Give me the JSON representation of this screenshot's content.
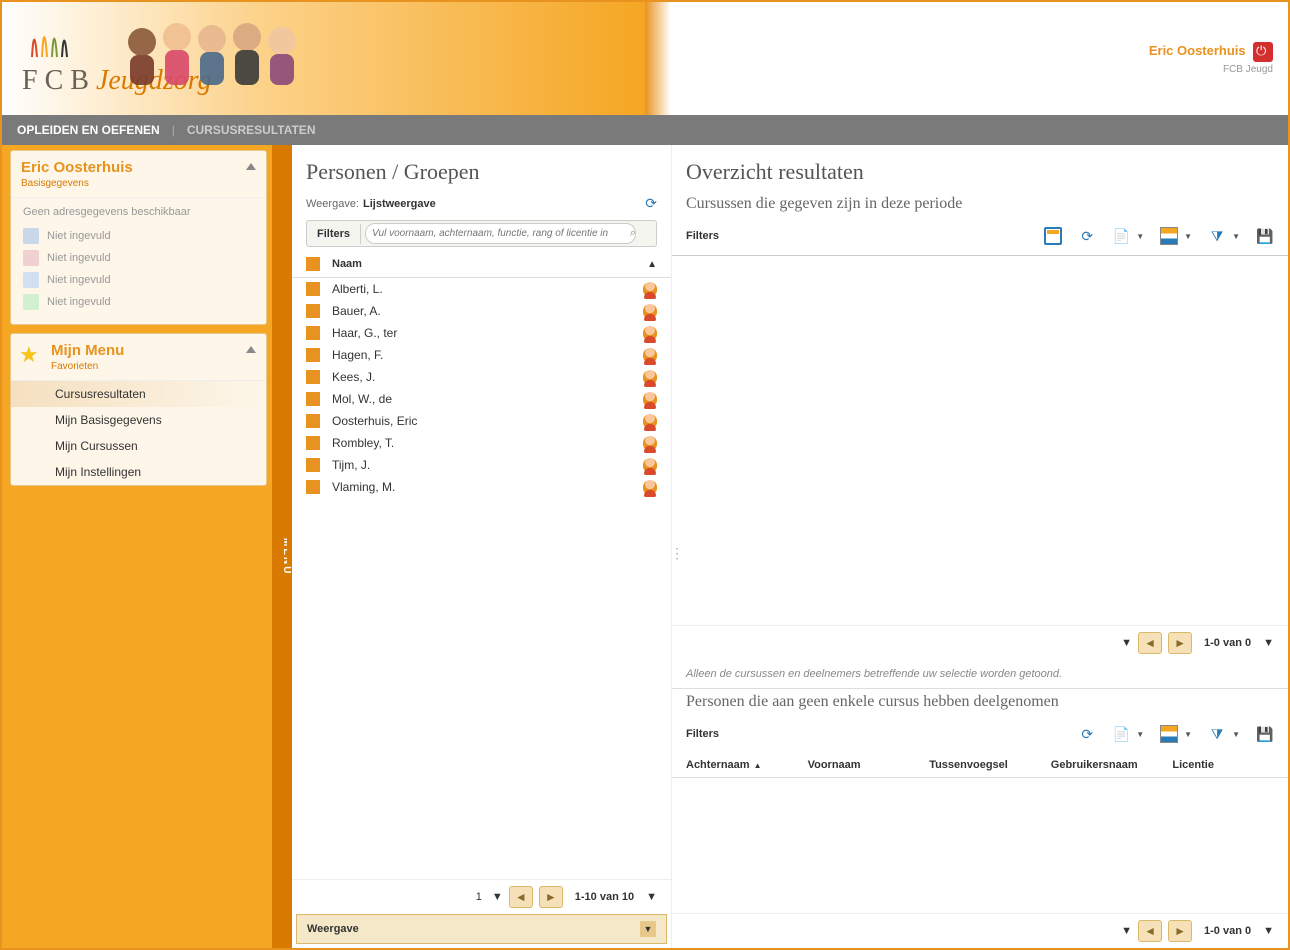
{
  "header": {
    "logo_main": "F C B",
    "logo_accent": "Jeugdzorg",
    "user_name": "Eric Oosterhuis",
    "user_org": "FCB Jeugd"
  },
  "nav": {
    "main": "OPLEIDEN EN OEFENEN",
    "sep": "|",
    "sub": "CURSUSRESULTATEN"
  },
  "sidebar": {
    "menu_tab": "MENU",
    "user_panel": {
      "title": "Eric Oosterhuis",
      "subtitle": "Basisgegevens",
      "no_address": "Geen adresgegevens beschikbaar",
      "lines": [
        "Niet ingevuld",
        "Niet ingevuld",
        "Niet ingevuld",
        "Niet ingevuld"
      ]
    },
    "menu_panel": {
      "title": "Mijn Menu",
      "subtitle": "Favorieten",
      "items": [
        "Cursusresultaten",
        "Mijn Basisgegevens",
        "Mijn Cursussen",
        "Mijn Instellingen"
      ]
    }
  },
  "left_col": {
    "title": "Personen / Groepen",
    "view_label": "Weergave:",
    "view_value": "Lijstweergave",
    "filter_label": "Filters",
    "filter_placeholder": "Vul voornaam, achternaam, functie, rang of licentie in",
    "name_header": "Naam",
    "persons": [
      "Alberti, L.",
      "Bauer, A.",
      "Haar, G., ter",
      "Hagen, F.",
      "Kees, J.",
      "Mol, W., de",
      "Oosterhuis, Eric",
      "Rombley, T.",
      "Tijm, J.",
      "Vlaming, M."
    ],
    "pager": {
      "page": "1",
      "range": "1-10 van 10"
    },
    "weergave_bar": "Weergave"
  },
  "right_col": {
    "title": "Overzicht resultaten",
    "subtitle1": "Cursussen die gegeven zijn in deze periode",
    "filters_label": "Filters",
    "pager1": {
      "range": "1-0 van 0"
    },
    "note": "Alleen de cursussen en deelnemers betreffende uw selectie worden getoond.",
    "subtitle2": "Personen die aan geen enkele cursus hebben deelgenomen",
    "table_cols": [
      "Achternaam",
      "Voornaam",
      "Tussenvoegsel",
      "Gebruikersnaam",
      "Licentie"
    ],
    "pager2": {
      "range": "1-0 van 0"
    }
  }
}
